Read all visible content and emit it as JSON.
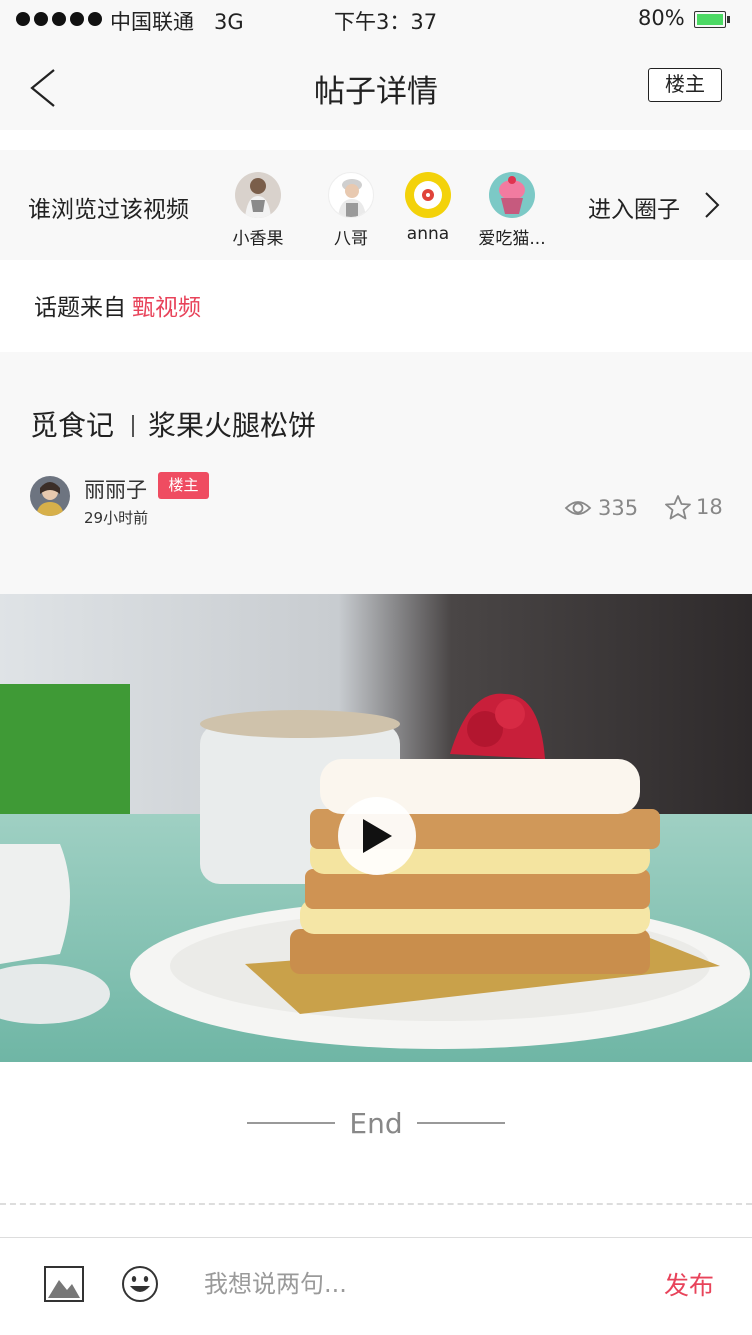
{
  "status_bar": {
    "carrier": "中国联通",
    "network": "3G",
    "time": "下午3：37",
    "battery": "80%"
  },
  "nav": {
    "title": "帖子详情",
    "owner_button": "楼主"
  },
  "viewers": {
    "label": "谁浏览过该视频",
    "users": [
      {
        "name": "小香果"
      },
      {
        "name": "八哥"
      },
      {
        "name": "anna"
      },
      {
        "name": "爱吃猫..."
      }
    ],
    "enter_circle": "进入圈子"
  },
  "topic": {
    "prefix": "话题来自",
    "source": "甄视频"
  },
  "post": {
    "category": "觅食记",
    "title": "浆果火腿松饼",
    "author": "丽丽子",
    "author_tag": "楼主",
    "time": "29小时前",
    "views": "335",
    "stars": "18"
  },
  "end_label": "End",
  "composer": {
    "placeholder": "我想说两句...",
    "publish": "发布"
  },
  "colors": {
    "accent": "#e8435a",
    "tag_bg": "#ef4c61",
    "battery": "#4cd964",
    "panel_bg": "#f8f8f8"
  }
}
